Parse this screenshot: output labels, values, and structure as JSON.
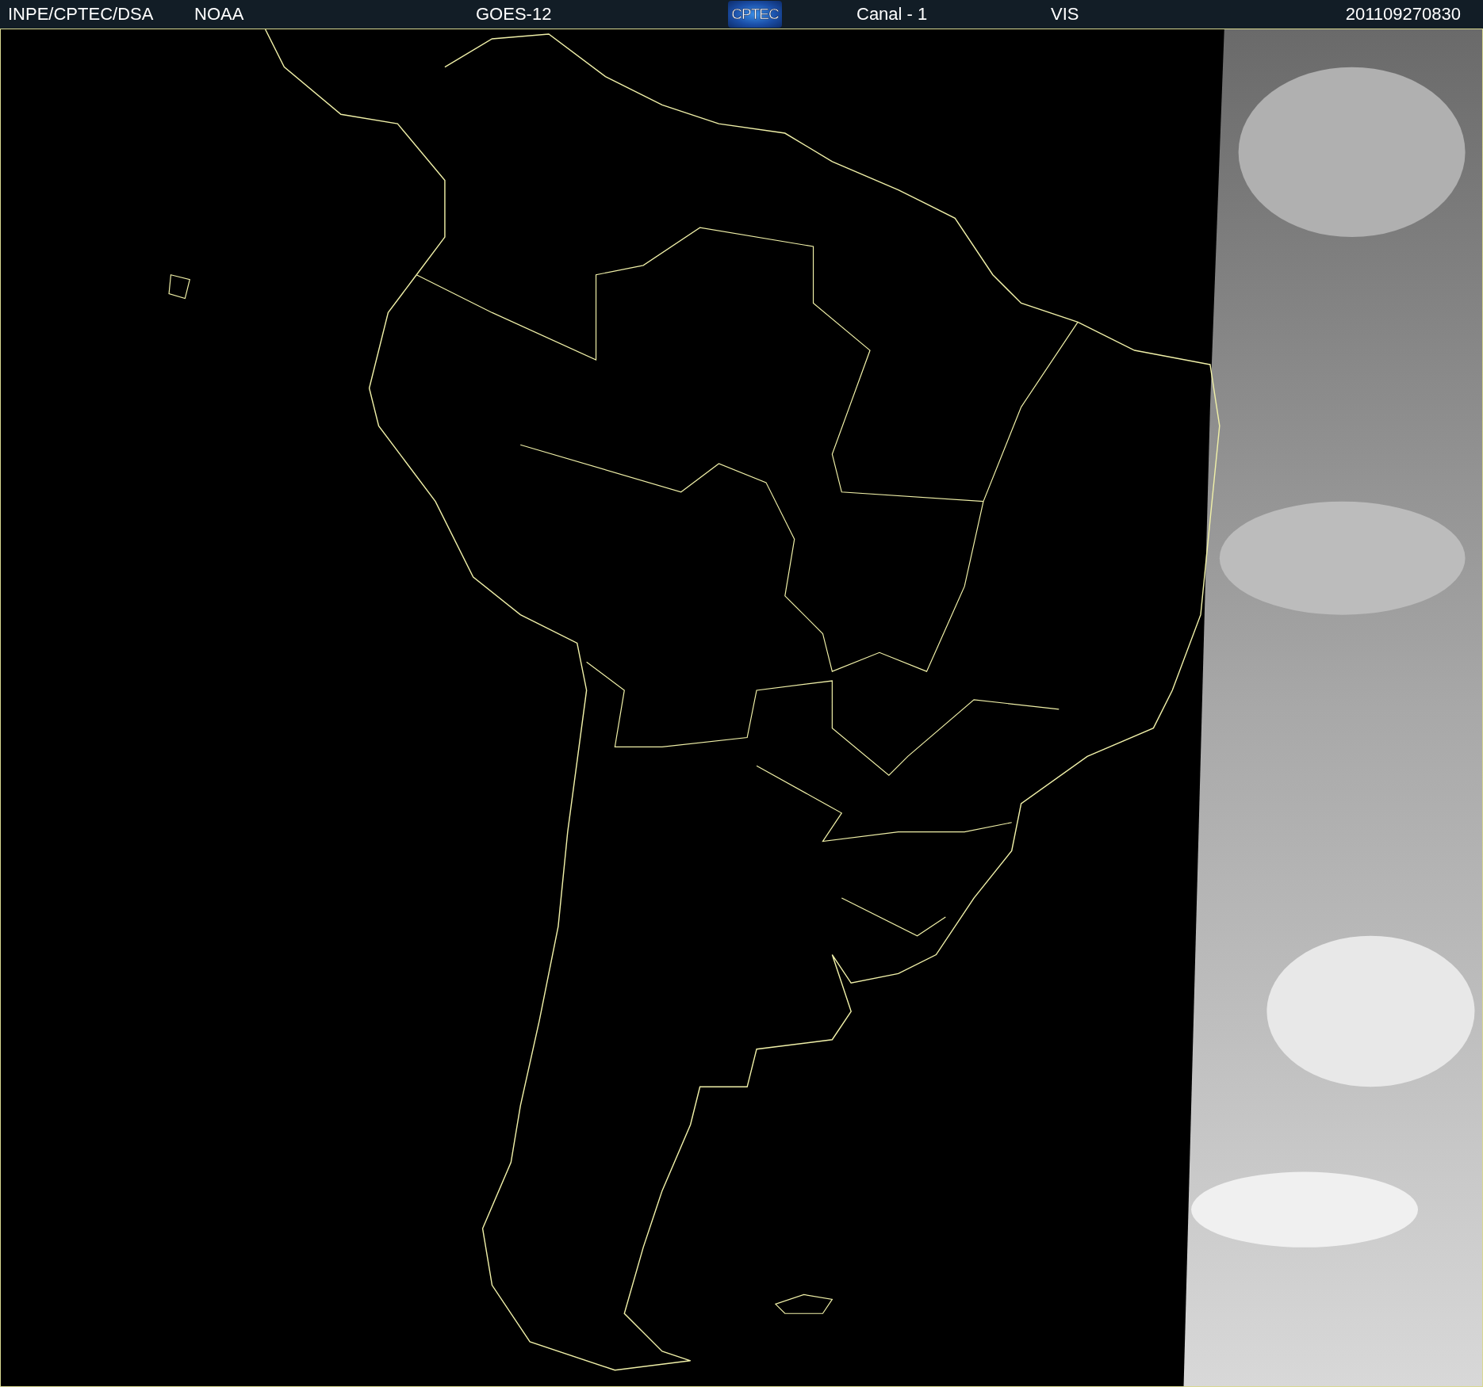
{
  "header": {
    "items": [
      {
        "kind": "text",
        "text": "INPE/CPTEC/DSA"
      },
      {
        "kind": "text",
        "text": "NOAA"
      },
      {
        "kind": "text",
        "text": "GOES-12"
      },
      {
        "kind": "logo",
        "text": "CPTEC"
      },
      {
        "kind": "text",
        "text": "Canal - 1"
      },
      {
        "kind": "text",
        "text": "VIS"
      },
      {
        "kind": "text",
        "text": "201109270830"
      }
    ]
  }
}
